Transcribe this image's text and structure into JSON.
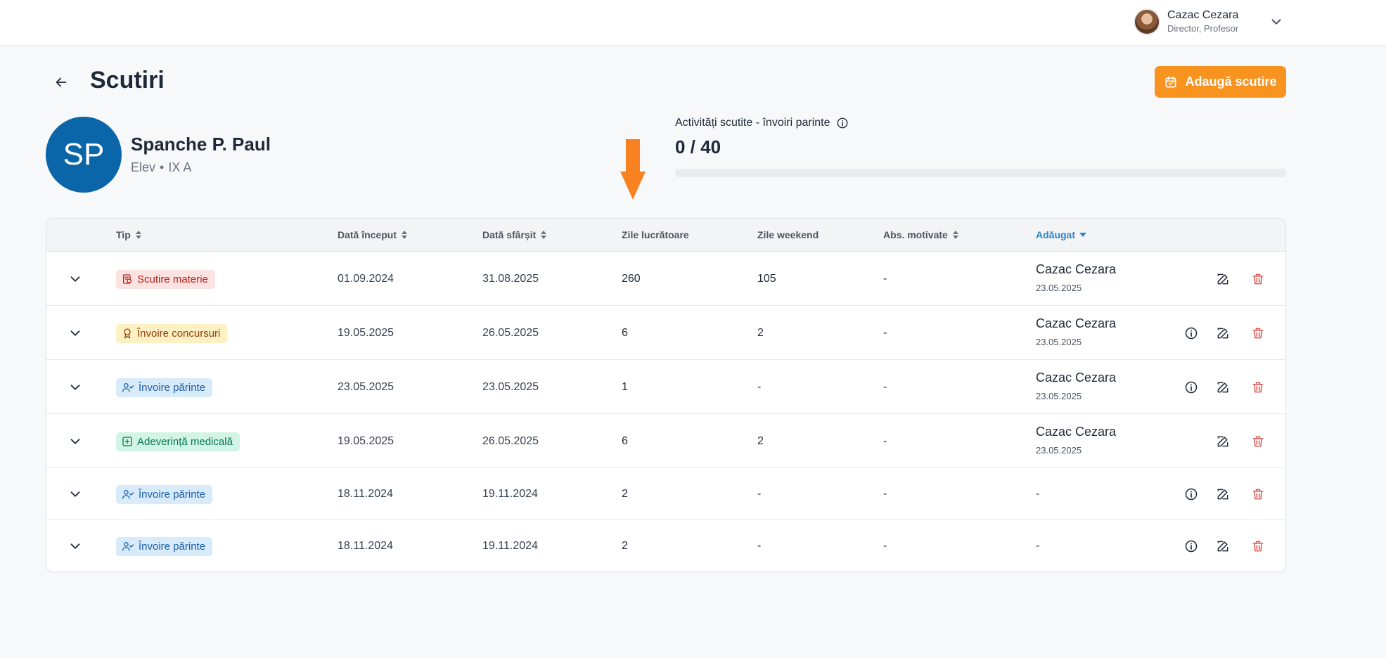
{
  "header": {
    "user_name": "Cazac Cezara",
    "user_role": "Director, Profesor"
  },
  "page": {
    "title": "Scutiri",
    "add_button": "Adaugă scutire"
  },
  "student": {
    "initials": "SP",
    "name": "Spanche P. Paul",
    "role": "Elev",
    "separator": "•",
    "class": "IX A"
  },
  "quota": {
    "label": "Activități scutite - învoiri parinte",
    "value": "0 / 40",
    "used": 0,
    "total": 40
  },
  "table": {
    "columns": {
      "type": "Tip",
      "start": "Dată început",
      "end": "Dată sfârșit",
      "workdays": "Zile lucrătoare",
      "weekend": "Zile weekend",
      "excused": "Abs. motivate",
      "added": "Adăugat"
    },
    "rows": [
      {
        "type": "Scutire materie",
        "color": "#b42318",
        "start": "01.09.2024",
        "end": "31.08.2025",
        "workdays": "260",
        "weekend": "105",
        "excused": "-",
        "added_by": "Cazac Cezara",
        "added_on": "23.05.2025",
        "has_info": false
      },
      {
        "type": "Învoire concursuri",
        "color": "#92400e",
        "start": "19.05.2025",
        "end": "26.05.2025",
        "workdays": "6",
        "weekend": "2",
        "excused": "-",
        "added_by": "Cazac Cezara",
        "added_on": "23.05.2025",
        "has_info": true
      },
      {
        "type": "Învoire părinte",
        "color": "#1d5fa5",
        "start": "23.05.2025",
        "end": "23.05.2025",
        "workdays": "1",
        "weekend": "-",
        "excused": "-",
        "added_by": "Cazac Cezara",
        "added_on": "23.05.2025",
        "has_info": true
      },
      {
        "type": "Adeverință medicală",
        "color": "#047857",
        "start": "19.05.2025",
        "end": "26.05.2025",
        "workdays": "6",
        "weekend": "2",
        "excused": "-",
        "added_by": "Cazac Cezara",
        "added_on": "23.05.2025",
        "has_info": false
      },
      {
        "type": "Învoire părinte",
        "color": "#1d5fa5",
        "start": "18.11.2024",
        "end": "19.11.2024",
        "workdays": "2",
        "weekend": "-",
        "excused": "-",
        "added_by": "-",
        "added_on": "",
        "has_info": true
      },
      {
        "type": "Învoire părinte",
        "color": "#1d5fa5",
        "start": "18.11.2024",
        "end": "19.11.2024",
        "workdays": "2",
        "weekend": "-",
        "excused": "-",
        "added_by": "-",
        "added_on": "",
        "has_info": true
      }
    ]
  },
  "colors": {
    "accent": "#f7931e",
    "primary": "#0a66a8",
    "sort_active": "#2a86c8",
    "annotation_arrow": "#f7821f",
    "delete": "#d9534f"
  }
}
